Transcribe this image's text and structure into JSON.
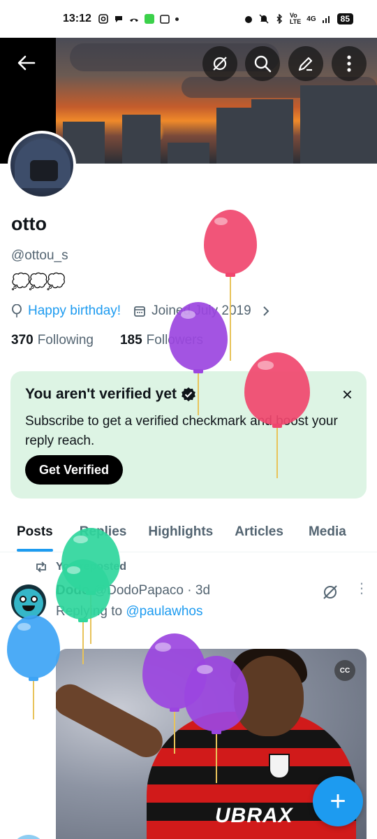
{
  "status_bar": {
    "time": "13:12",
    "network": "4G",
    "battery": "85"
  },
  "header": {
    "back_icon": "arrow-left-icon",
    "grok_icon": "grok-icon",
    "search_icon": "search-icon",
    "edit_icon": "pencil-icon",
    "more_icon": "more-vertical-icon"
  },
  "profile": {
    "name": "otto",
    "handle": "@ottou_s",
    "bio": "💭💭💭",
    "birthday_link": "Happy birthday!",
    "joined": "Joined July 2019",
    "following_count": "370",
    "following_label": "Following",
    "followers_count": "185",
    "followers_label": "Followers"
  },
  "verify_card": {
    "title": "You aren't verified yet",
    "description": "Subscribe to get a verified checkmark and boost your reply reach.",
    "button": "Get Verified",
    "close": "×"
  },
  "tabs": [
    "Posts",
    "Replies",
    "Highlights",
    "Articles",
    "Media"
  ],
  "post": {
    "repost_label": "You reposted",
    "display_name": "Dodo",
    "username": "@DodoPapaco",
    "age": "3d",
    "replying_prefix": "Replying to",
    "replying_to": "@paulawhos",
    "media_badge": "CC",
    "media_text": "UBRAX"
  },
  "fab": {
    "label": "+"
  },
  "colors": {
    "accent": "#1d9bf0",
    "verify_bg": "#ddf4e4",
    "secondary_text": "#536471",
    "balloon_pink": "#f0466e",
    "balloon_purple": "#9b45e0",
    "balloon_green": "#2fd69c",
    "balloon_blue": "#3da4f5"
  }
}
